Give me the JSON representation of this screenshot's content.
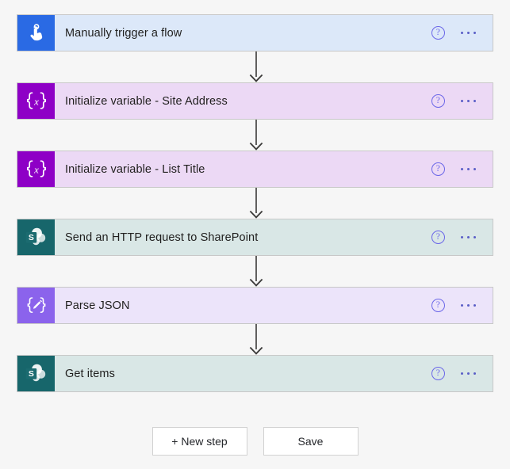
{
  "canvas": {
    "background_color": "#f6f6f6"
  },
  "flow": {
    "steps": [
      {
        "title": "Manually trigger a flow",
        "icon": "touch-pointer-icon",
        "icon_color": "#2a6ae4",
        "body_color": "#dce8f9",
        "help_label": "?",
        "menu_label": "More commands"
      },
      {
        "title": "Initialize variable - Site Address",
        "icon": "variable-braces-icon",
        "icon_color": "#8e00c6",
        "body_color": "#ecd9f5",
        "help_label": "?",
        "menu_label": "More commands"
      },
      {
        "title": "Initialize variable - List Title",
        "icon": "variable-braces-icon",
        "icon_color": "#8e00c6",
        "body_color": "#ecd9f5",
        "help_label": "?",
        "menu_label": "More commands"
      },
      {
        "title": "Send an HTTP request to SharePoint",
        "icon": "sharepoint-icon",
        "icon_color": "#17666b",
        "body_color": "#d9e7e6",
        "help_label": "?",
        "menu_label": "More commands"
      },
      {
        "title": "Parse JSON",
        "icon": "parse-json-icon",
        "icon_color": "#8b63ec",
        "body_color": "#ece4fa",
        "help_label": "?",
        "menu_label": "More commands"
      },
      {
        "title": "Get items",
        "icon": "sharepoint-icon",
        "icon_color": "#17666b",
        "body_color": "#d9e7e6",
        "help_label": "?",
        "menu_label": "More commands"
      }
    ]
  },
  "toolbar": {
    "new_step_label": "+ New step",
    "save_label": "Save"
  }
}
